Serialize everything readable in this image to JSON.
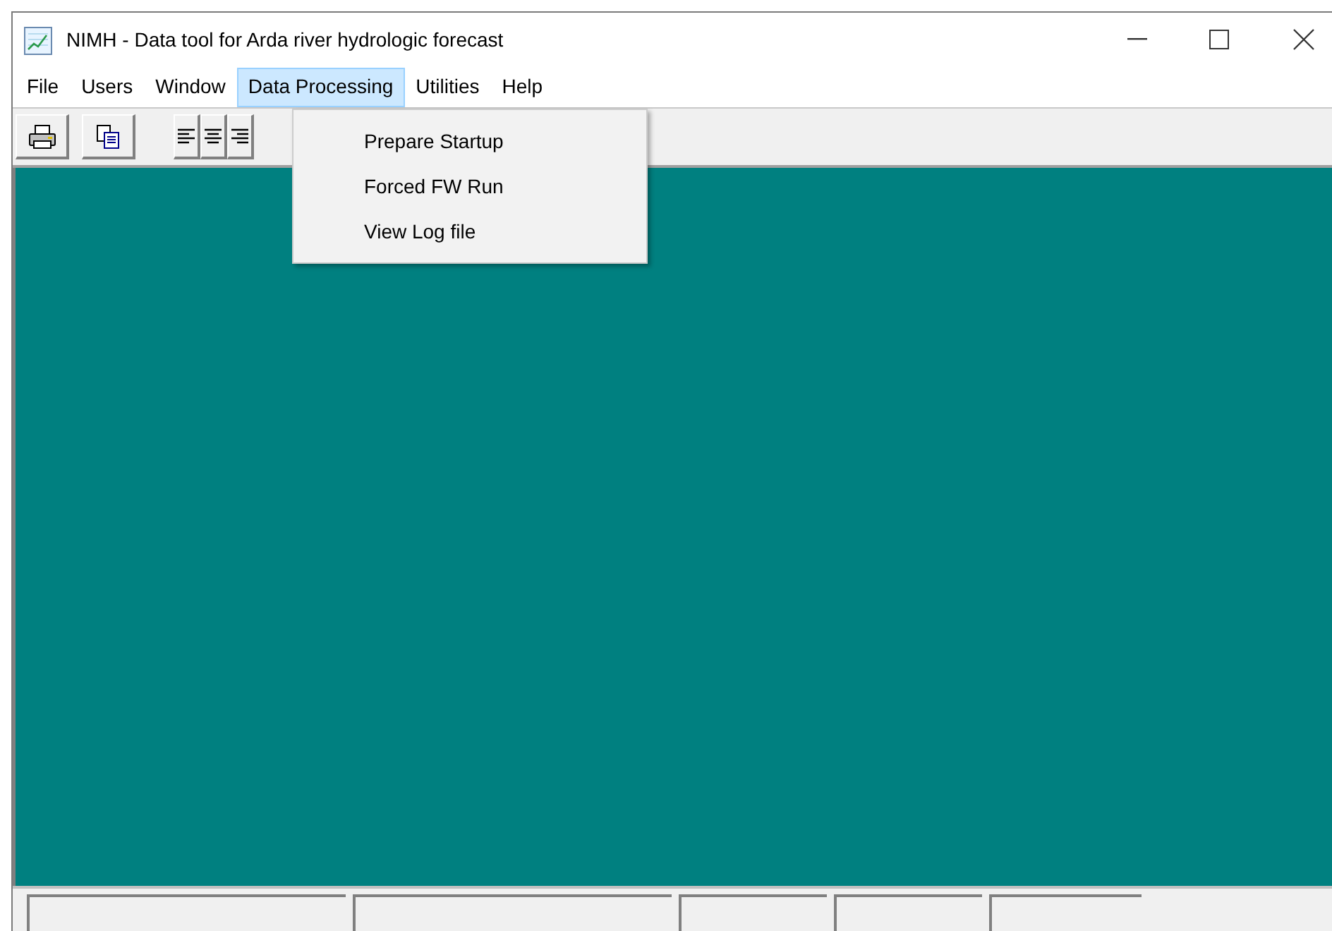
{
  "window": {
    "title": "NIMH - Data tool for Arda river hydrologic forecast"
  },
  "menu_bar": [
    {
      "label": "File",
      "selected": false
    },
    {
      "label": "Users",
      "selected": false
    },
    {
      "label": "Window",
      "selected": false
    },
    {
      "label": "Data Processing",
      "selected": true
    },
    {
      "label": "Utilities",
      "selected": false
    },
    {
      "label": "Help",
      "selected": false
    }
  ],
  "dropdown": [
    "Prepare Startup",
    "Forced FW Run",
    "View Log file"
  ],
  "toolbar": [
    {
      "kind": "print"
    },
    {
      "kind": "copy"
    },
    {
      "kind": "gap"
    },
    {
      "kind": "align-left"
    },
    {
      "kind": "align-center"
    },
    {
      "kind": "align-right"
    }
  ]
}
